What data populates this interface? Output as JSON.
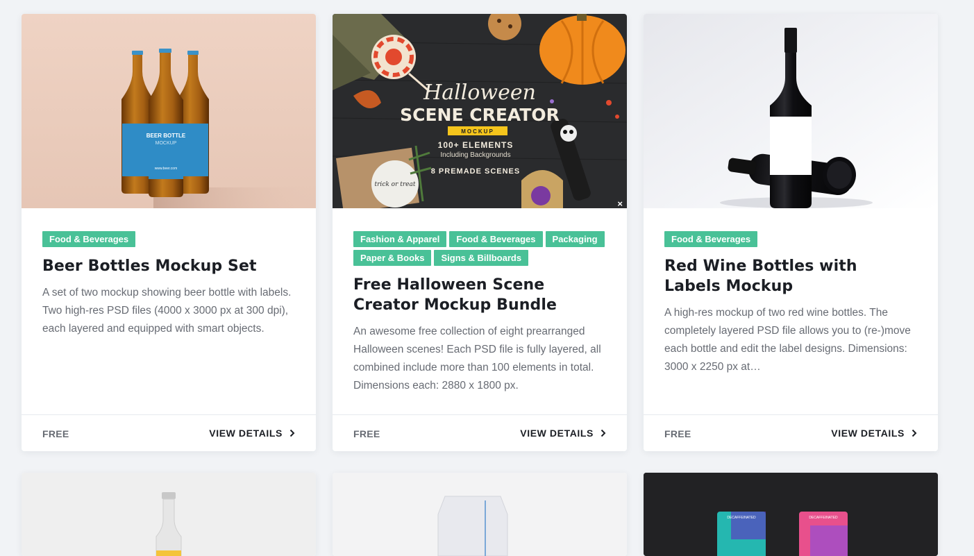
{
  "cards": [
    {
      "tags": [
        "Food & Beverages"
      ],
      "title": "Beer Bottles Mockup Set",
      "description": "A set of two mockup showing beer bottle with labels. Two high-res PSD files (4000 x 3000 px at 300 dpi), each layered and equipped with smart objects.",
      "price": "FREE",
      "details_label": "VIEW DETAILS",
      "thumb_label": "BEER BOTTLE",
      "thumb_sublabel": "MOCKUP",
      "thumb_url": "www.beer.com"
    },
    {
      "tags": [
        "Fashion & Apparel",
        "Food & Beverages",
        "Packaging",
        "Paper & Books",
        "Signs & Billboards"
      ],
      "title": "Free Halloween Scene Creator Mockup Bundle",
      "description": "An awesome free collection of eight prearranged Halloween scenes! Each PSD file is fully layered, all combined include more than 100 elements in total. Dimensions each: 2880 x 1800 px.",
      "price": "FREE",
      "details_label": "VIEW DETAILS",
      "thumb_script": "Halloween",
      "thumb_title": "SCENE CREATOR",
      "thumb_badge": "MOCKUP",
      "thumb_line1": "100+ ELEMENTS",
      "thumb_line2": "Including Backgrounds",
      "thumb_line3": "8 PREMADE SCENES",
      "thumb_note": "trick or treat",
      "close_glyph": "×"
    },
    {
      "tags": [
        "Food & Beverages"
      ],
      "title": "Red Wine Bottles with Labels Mockup",
      "description": "A high-res mockup of two red wine bottles. The completely layered PSD file allows you to (re-)move each bottle and edit the label designs. Dimensions: 3000 x 2250 px at…",
      "price": "FREE",
      "details_label": "VIEW DETAILS"
    }
  ],
  "bottom_cards": [
    {
      "thumb_label": ""
    },
    {
      "thumb_label": ""
    },
    {
      "thumb_label1": "DECAFFEINATED",
      "thumb_label2": "DECAFFEINATED"
    }
  ],
  "colors": {
    "tag_bg": "#49c197",
    "title": "#1b1e24",
    "body_text": "#676b73",
    "page_bg": "#f1f3f6"
  }
}
